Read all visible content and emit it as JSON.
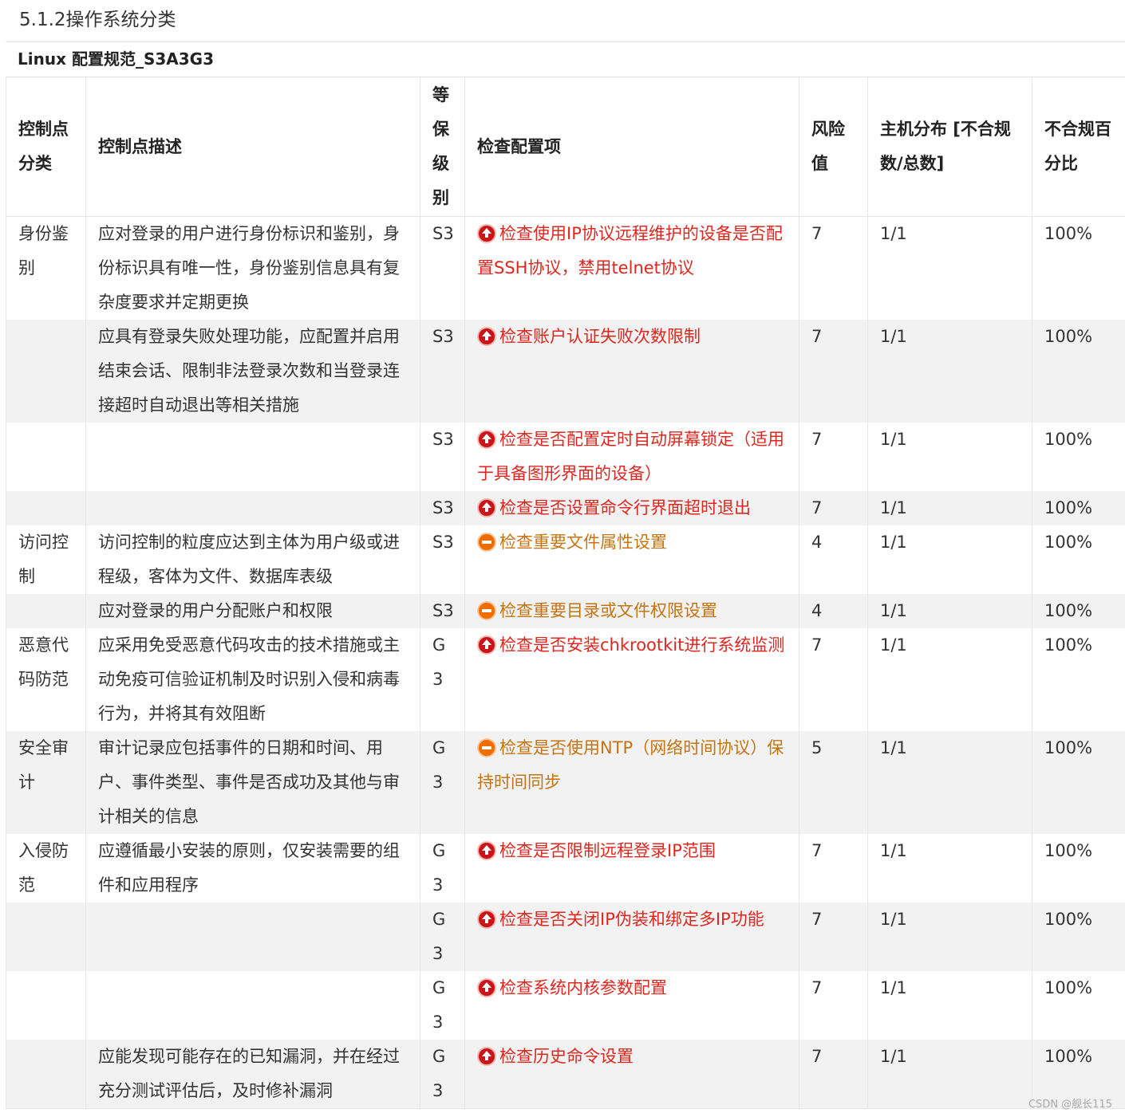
{
  "section_title": "5.1.2操作系统分类",
  "table_caption": "Linux 配置规范_S3A3G3",
  "headers": {
    "category": "控制点分类",
    "description": "控制点描述",
    "level": "等保级别",
    "check_item": "检查配置项",
    "risk": "风险值",
    "host_dist": "主机分布 [不合规数/总数]",
    "noncompliance": "不合规百分比"
  },
  "colors": {
    "high_risk": "#e0261f",
    "medium_risk": "#c47412",
    "row_stripe": "#f2f2f2"
  },
  "rows": [
    {
      "category": "身份鉴别",
      "description": "应对登录的用户进行身份标识和鉴别，身份标识具有唯一性，身份鉴别信息具有复杂度要求并定期更换",
      "level": "S3",
      "icon": "high-risk-icon",
      "check_item": "检查使用IP协议远程维护的设备是否配置SSH协议，禁用telnet协议",
      "risk": "7",
      "hosts": "1/1",
      "percent": "100%"
    },
    {
      "category": "",
      "description": "应具有登录失败处理功能，应配置并启用结束会话、限制非法登录次数和当登录连接超时自动退出等相关措施",
      "level": "S3",
      "icon": "high-risk-icon",
      "check_item": "检查账户认证失败次数限制",
      "risk": "7",
      "hosts": "1/1",
      "percent": "100%"
    },
    {
      "category": "",
      "description": "",
      "level": "S3",
      "icon": "high-risk-icon",
      "check_item": "检查是否配置定时自动屏幕锁定（适用于具备图形界面的设备）",
      "risk": "7",
      "hosts": "1/1",
      "percent": "100%"
    },
    {
      "category": "",
      "description": "",
      "level": "S3",
      "icon": "high-risk-icon",
      "check_item": "检查是否设置命令行界面超时退出",
      "risk": "7",
      "hosts": "1/1",
      "percent": "100%"
    },
    {
      "category": "访问控制",
      "description": "访问控制的粒度应达到主体为用户级或进程级，客体为文件、数据库表级",
      "level": "S3",
      "icon": "medium-risk-icon",
      "check_item": "检查重要文件属性设置",
      "risk": "4",
      "hosts": "1/1",
      "percent": "100%"
    },
    {
      "category": "",
      "description": "应对登录的用户分配账户和权限",
      "level": "S3",
      "icon": "medium-risk-icon",
      "check_item": "检查重要目录或文件权限设置",
      "risk": "4",
      "hosts": "1/1",
      "percent": "100%"
    },
    {
      "category": "恶意代码防范",
      "description": "应采用免受恶意代码攻击的技术措施或主动免疫可信验证机制及时识别入侵和病毒行为，并将其有效阻断",
      "level": "G3",
      "icon": "high-risk-icon",
      "check_item": "检查是否安装chkrootkit进行系统监测",
      "risk": "7",
      "hosts": "1/1",
      "percent": "100%"
    },
    {
      "category": "安全审计",
      "description": "审计记录应包括事件的日期和时间、用户、事件类型、事件是否成功及其他与审计相关的信息",
      "level": "G3",
      "icon": "medium-risk-icon",
      "check_item": "检查是否使用NTP（网络时间协议）保持时间同步",
      "risk": "5",
      "hosts": "1/1",
      "percent": "100%"
    },
    {
      "category": "入侵防范",
      "description": "应遵循最小安装的原则，仅安装需要的组件和应用程序",
      "level": "G3",
      "icon": "high-risk-icon",
      "check_item": "检查是否限制远程登录IP范围",
      "risk": "7",
      "hosts": "1/1",
      "percent": "100%"
    },
    {
      "category": "",
      "description": "",
      "level": "G3",
      "icon": "high-risk-icon",
      "check_item": "检查是否关闭IP伪装和绑定多IP功能",
      "risk": "7",
      "hosts": "1/1",
      "percent": "100%"
    },
    {
      "category": "",
      "description": "",
      "level": "G3",
      "icon": "high-risk-icon",
      "check_item": "检查系统内核参数配置",
      "risk": "7",
      "hosts": "1/1",
      "percent": "100%"
    },
    {
      "category": "",
      "description": "应能发现可能存在的已知漏洞，并在经过充分测试评估后，及时修补漏洞",
      "level": "G3",
      "icon": "high-risk-icon",
      "check_item": "检查历史命令设置",
      "risk": "7",
      "hosts": "1/1",
      "percent": "100%"
    }
  ],
  "watermark": "CSDN @舰长115"
}
